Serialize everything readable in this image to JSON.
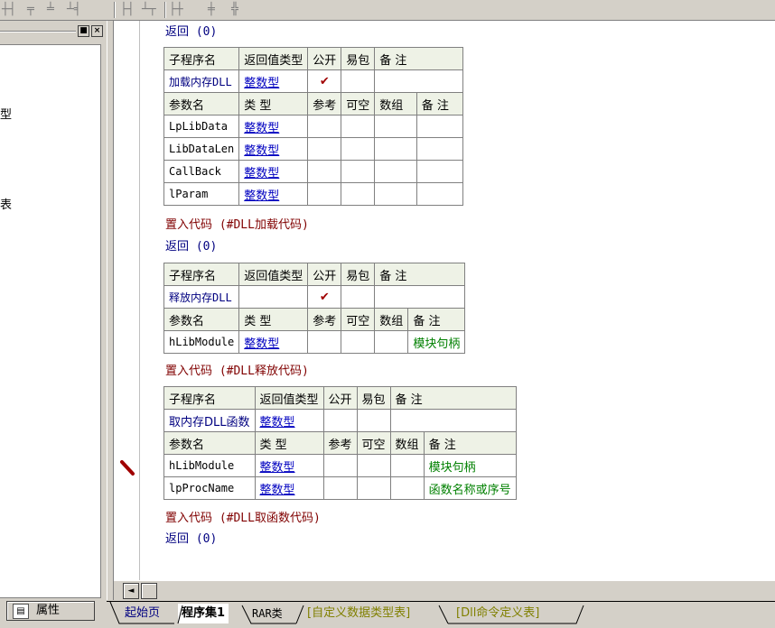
{
  "toolbar": {
    "icons": [
      "align-left-icon",
      "align-center-icon",
      "align-top-icon",
      "distribute-icon",
      "same-width-icon",
      "same-height-icon",
      "resize-width-icon",
      "resize-height-icon",
      "center-icon"
    ],
    "glyphs": [
      "┼┤",
      "╤",
      "╧",
      "┴╡",
      "├┤",
      "┴┬",
      "├┼",
      "╪",
      "╬"
    ]
  },
  "left_panel": {
    "items": [
      "型",
      "表"
    ],
    "min_button": "■",
    "close_button": "×",
    "properties_tab": "属性"
  },
  "code": {
    "top_return": "返回 (0)",
    "tables": [
      {
        "header": [
          "子程序名",
          "返回值类型",
          "公开",
          "易包",
          "备 注"
        ],
        "name": "加载内存DLL",
        "return_type": "整数型",
        "public": "✔",
        "param_header": [
          "参数名",
          "类 型",
          "参考",
          "可空",
          "数组",
          "备 注"
        ],
        "params": [
          {
            "name": "LpLibData",
            "type": "整数型",
            "note": ""
          },
          {
            "name": "LibDataLen",
            "type": "整数型",
            "note": ""
          },
          {
            "name": "CallBack",
            "type": "整数型",
            "note": ""
          },
          {
            "name": "lParam",
            "type": "整数型",
            "note": ""
          }
        ],
        "insert_code": "置入代码 (#DLL加载代码)",
        "return_line": "返回 (0)"
      },
      {
        "header": [
          "子程序名",
          "返回值类型",
          "公开",
          "易包",
          "备 注"
        ],
        "name": "释放内存DLL",
        "return_type": "",
        "public": "✔",
        "param_header": [
          "参数名",
          "类 型",
          "参考",
          "可空",
          "数组",
          "备 注"
        ],
        "params": [
          {
            "name": "hLibModule",
            "type": "整数型",
            "note": "模块句柄"
          }
        ],
        "insert_code": "置入代码 (#DLL释放代码)",
        "return_line": ""
      },
      {
        "header": [
          "子程序名",
          "返回值类型",
          "公开",
          "易包",
          "备 注"
        ],
        "name": "取内存DLL函数",
        "return_type": "整数型",
        "public": "",
        "param_header": [
          "参数名",
          "类 型",
          "参考",
          "可空",
          "数组",
          "备 注"
        ],
        "params": [
          {
            "name": "hLibModule",
            "type": "整数型",
            "note": "模块句柄"
          },
          {
            "name": "lpProcName",
            "type": "整数型",
            "note": "函数名称或序号"
          }
        ],
        "insert_code": "置入代码 (#DLL取函数代码)",
        "return_line": "返回 (0)"
      }
    ]
  },
  "scrollbar": {
    "left_arrow": "◄"
  },
  "tabs": [
    "起始页",
    "程序集1",
    "RAR类",
    "[自定义数据类型表]",
    "[Dll命令定义表]"
  ],
  "active_tab": "程序集1",
  "colors": {
    "header_bg": "#eef2e6",
    "type_link": "#0000c0",
    "note_green": "#008000",
    "tick": "#a00000"
  }
}
